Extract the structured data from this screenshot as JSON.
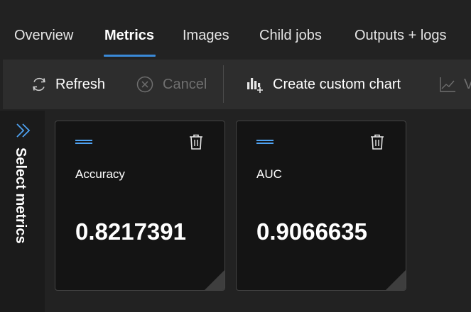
{
  "tabs": [
    {
      "label": "Overview"
    },
    {
      "label": "Metrics"
    },
    {
      "label": "Images"
    },
    {
      "label": "Child jobs"
    },
    {
      "label": "Outputs + logs"
    }
  ],
  "active_tab": "Metrics",
  "toolbar": {
    "refresh_label": "Refresh",
    "cancel_label": "Cancel",
    "create_chart_label": "Create custom chart",
    "view_label": "V"
  },
  "rail": {
    "label": "Select metrics"
  },
  "cards": [
    {
      "name": "Accuracy",
      "value": "0.8217391"
    },
    {
      "name": "AUC",
      "value": "0.9066635"
    }
  ],
  "colors": {
    "accent": "#3a8ad8",
    "background": "#222222",
    "toolbar": "#2d2d2d",
    "card": "#141414",
    "disabled": "#6f6f6f"
  }
}
